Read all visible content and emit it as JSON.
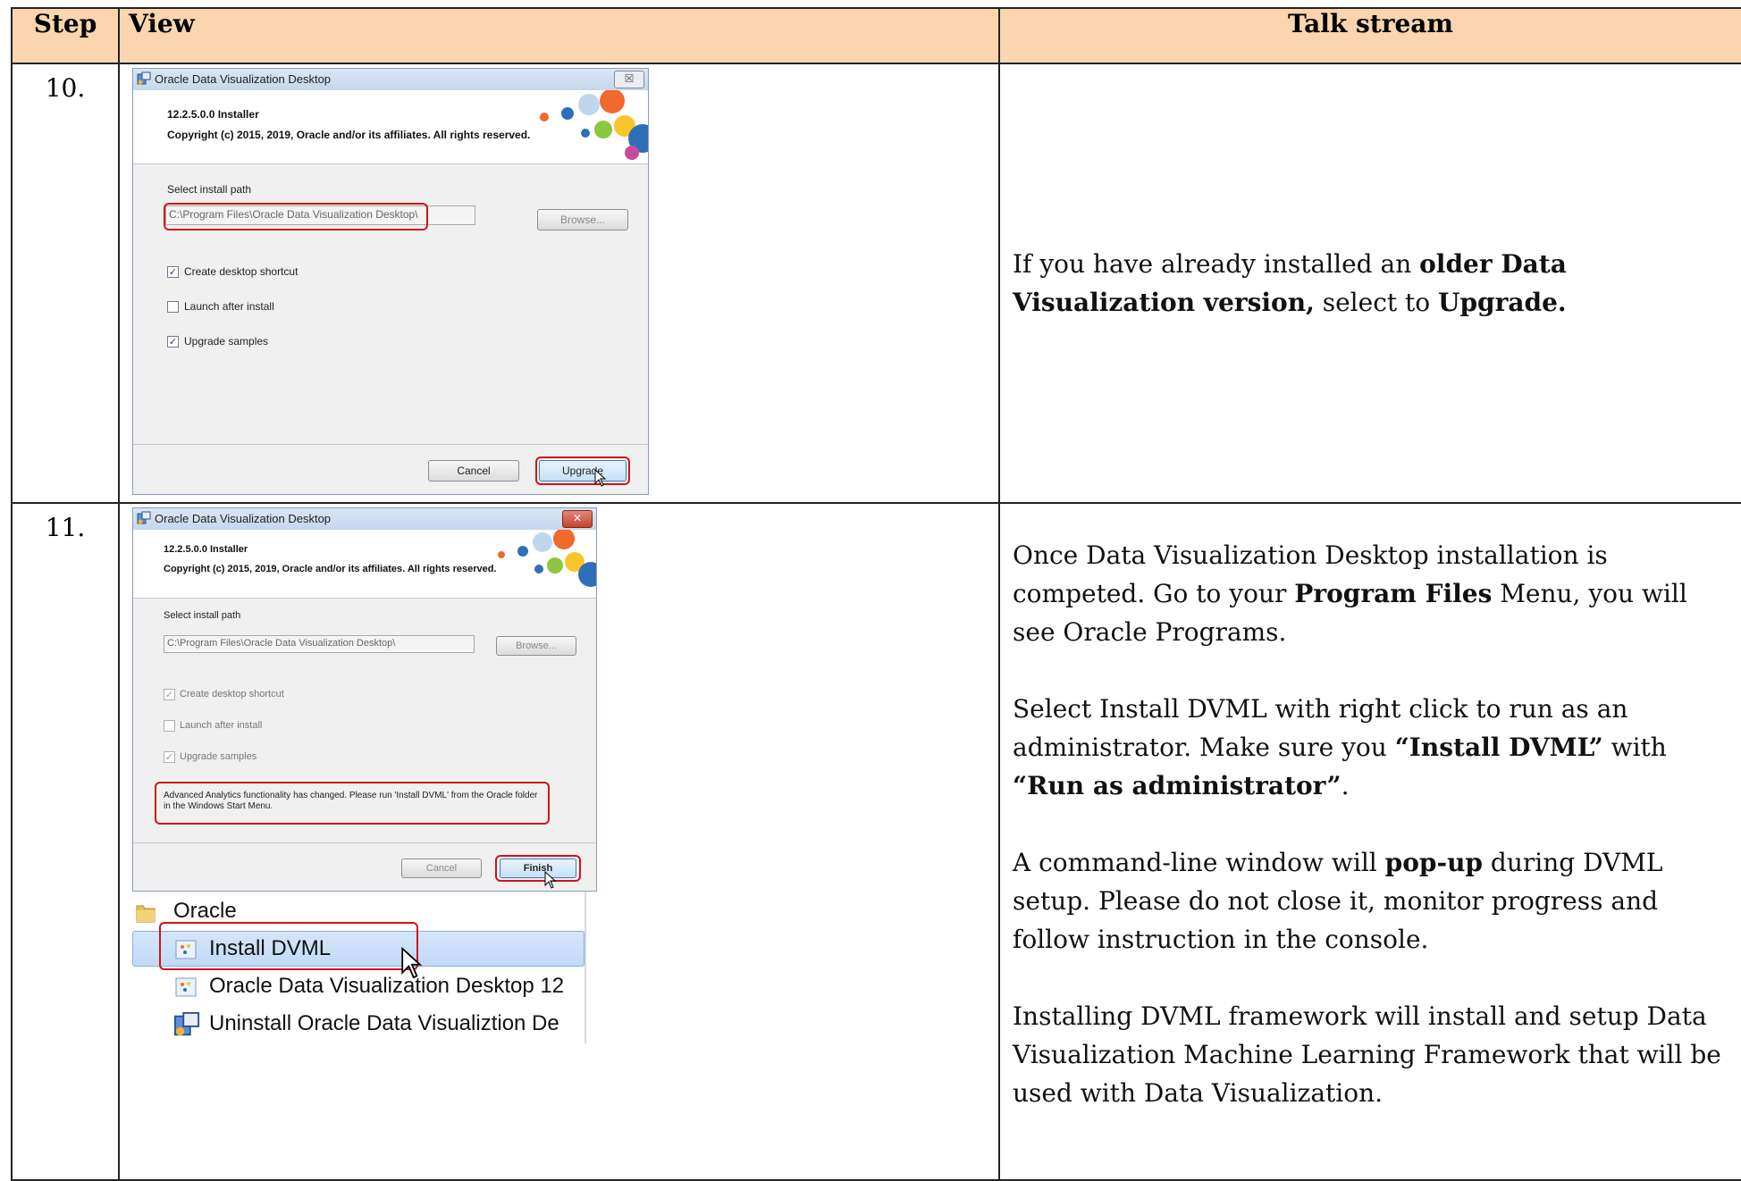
{
  "table": {
    "headers": {
      "step": "Step",
      "view": "View",
      "talk": "Talk stream"
    },
    "rows": [
      {
        "step": "10.",
        "talk": {
          "p1_pre": "If you have already installed an ",
          "p1_b1": "older Data Visualization version,",
          "p1_mid": " select to ",
          "p1_b2": "Upgrade."
        }
      },
      {
        "step": "11.",
        "talk": {
          "p1": "Once Data Visualization Desktop installation is competed. Go to your ",
          "p1_b": "Program Files",
          "p1_end": " Menu, you will see Oracle Programs.",
          "p2": "Select Install DVML with right click to run as an administrator. Make sure you ",
          "p2_b1": "“Install DVML”",
          "p2_mid": " with ",
          "p2_b2": "“Run as administrator”",
          "p2_end": ".",
          "p3": "A command-line window will ",
          "p3_b": "pop-up",
          "p3_end": " during DVML setup. Please do not close it, monitor progress and follow instruction in the console.",
          "p4": "Installing DVML framework will install and setup Data Visualization Machine Learning Framework that will be used with Data Visualization."
        }
      }
    ]
  },
  "installer1": {
    "title": "Oracle Data Visualization Desktop",
    "close": "☒",
    "version": "12.2.5.0.0 Installer",
    "copyright": "Copyright (c) 2015, 2019, Oracle and/or its affiliates. All rights reserved.",
    "path_label": "Select install path",
    "path_value": "C:\\Program Files\\Oracle Data Visualization Desktop\\",
    "browse": "Browse...",
    "opt1": "Create desktop shortcut",
    "opt1_checked": true,
    "opt2": "Launch after install",
    "opt2_checked": false,
    "opt3": "Upgrade samples",
    "opt3_checked": true,
    "cancel": "Cancel",
    "upgrade": "Upgrade"
  },
  "installer2": {
    "title": "Oracle Data Visualization Desktop",
    "close": "✕",
    "version": "12.2.5.0.0 Installer",
    "copyright": "Copyright (c) 2015, 2019, Oracle and/or its affiliates. All rights reserved.",
    "path_label": "Select install path",
    "path_value": "C:\\Program Files\\Oracle Data Visualization Desktop\\",
    "browse": "Browse...",
    "opt1": "Create desktop shortcut",
    "opt2": "Launch after install",
    "opt3": "Upgrade samples",
    "message": "Advanced Analytics functionality has changed.  Please run 'Install DVML' from the Oracle folder in the Windows Start Menu.",
    "cancel": "Cancel",
    "finish": "Finish"
  },
  "start_menu": {
    "folder": "Oracle",
    "item1": "Install DVML",
    "item2": "Oracle Data Visualization Desktop 12",
    "item3": "Uninstall Oracle Data Visualiztion De"
  },
  "colors": {
    "header_bg": "#fad5b0",
    "highlight_red": "#d0121b"
  }
}
